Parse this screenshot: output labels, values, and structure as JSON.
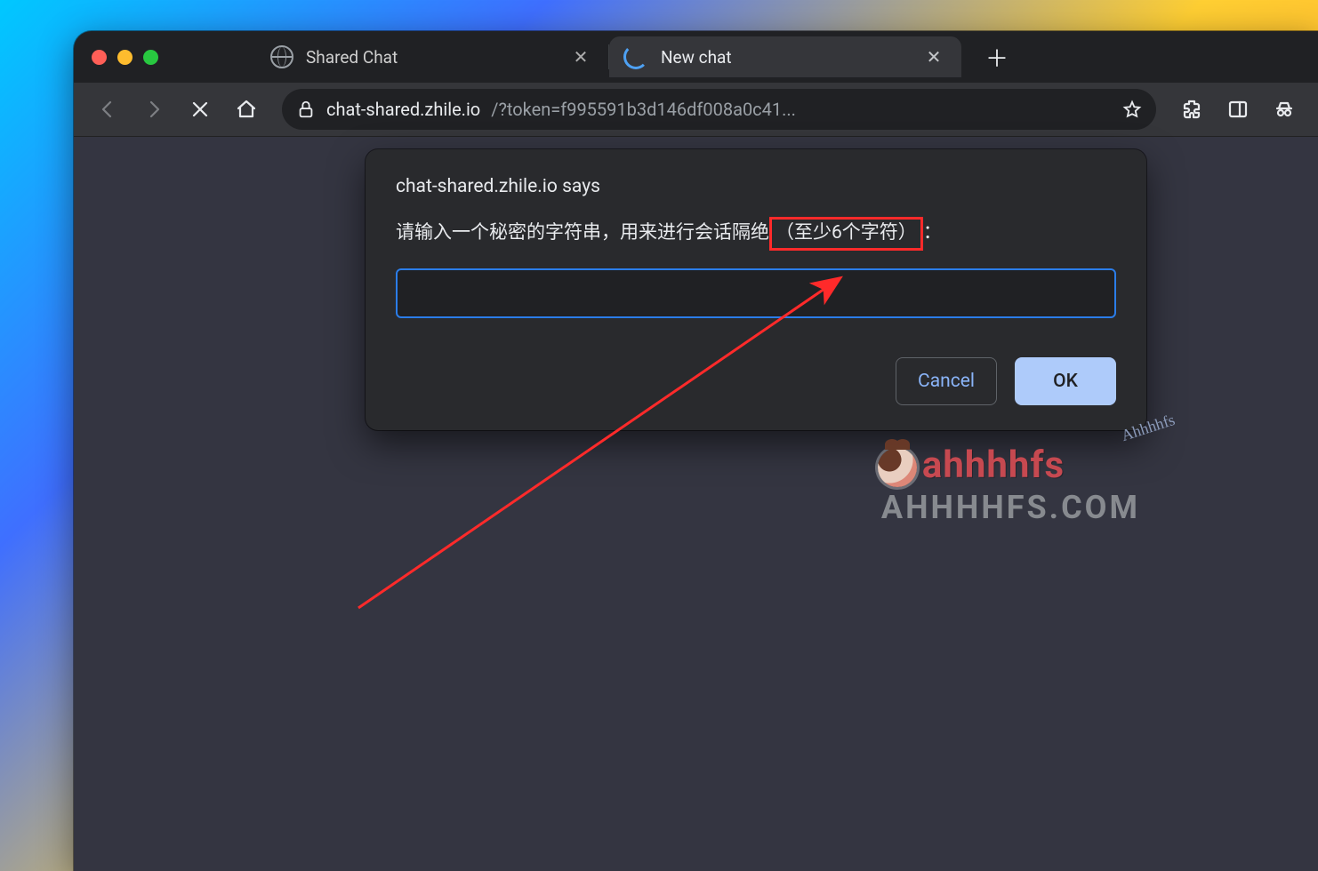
{
  "tabs": {
    "tab1": {
      "title": "Shared Chat"
    },
    "tab2": {
      "title": "New chat"
    }
  },
  "address": {
    "host": "chat-shared.zhile.io",
    "rest": "/?token=f995591b3d146df008a0c41..."
  },
  "dialog": {
    "origin_says": "chat-shared.zhile.io says",
    "message_part1": "请输入一个秘密的字符串，用来进行会话隔绝",
    "message_highlight": "（至少6个字符）",
    "message_part2": "：",
    "input_value": "",
    "cancel_label": "Cancel",
    "ok_label": "OK"
  },
  "watermark": {
    "logo": "ahhhhfs",
    "sub": "AHHHHFS.COM",
    "script": "Ahhhhfs"
  }
}
